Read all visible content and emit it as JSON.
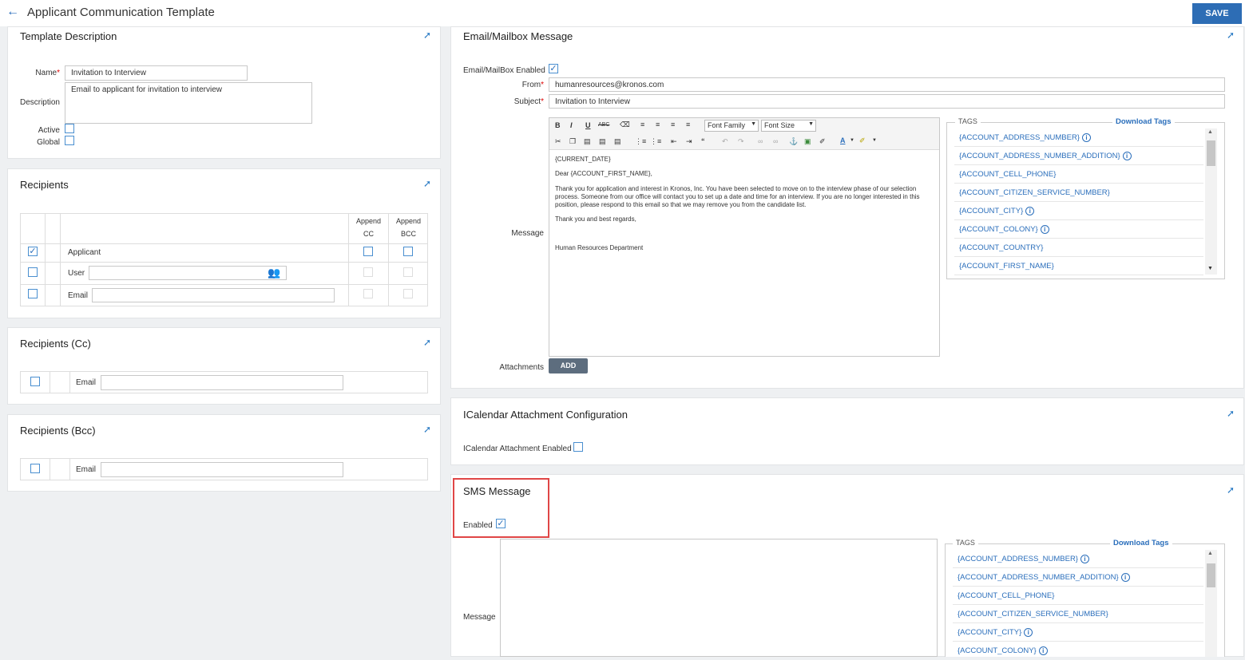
{
  "header": {
    "title": "Applicant Communication Template",
    "save_label": "SAVE"
  },
  "template_description": {
    "title": "Template Description",
    "name_label": "Name",
    "name_value": "Invitation to Interview",
    "description_label": "Description",
    "description_value": "Email to applicant for invitation to interview",
    "active_label": "Active",
    "global_label": "Global"
  },
  "recipients": {
    "title": "Recipients",
    "col_cc_1": "Append",
    "col_cc_2": "CC",
    "col_bcc_1": "Append",
    "col_bcc_2": "BCC",
    "rows": [
      {
        "label": "Applicant",
        "checked": true
      },
      {
        "label": "User",
        "checked": false
      },
      {
        "label": "Email",
        "checked": false
      }
    ]
  },
  "recipients_cc": {
    "title": "Recipients (Cc)",
    "email_label": "Email"
  },
  "recipients_bcc": {
    "title": "Recipients (Bcc)",
    "email_label": "Email"
  },
  "email_message": {
    "title": "Email/Mailbox Message",
    "enabled_label": "Email/MailBox Enabled",
    "from_label": "From",
    "from_value": "humanresources@kronos.com",
    "subject_label": "Subject",
    "subject_value": "Invitation to Interview",
    "message_label": "Message",
    "font_family": "Font Family",
    "font_size": "Font Size",
    "body": {
      "line1": "{CURRENT_DATE}",
      "line2": "Dear {ACCOUNT_FIRST_NAME},",
      "para1": "Thank you for application and interest in Kronos, Inc. You have been selected to move on to the interview phase of our selection process. Someone from our office will contact you to set up a date and time for an interview. If you are no longer interested in this position, please respond to this email so that we may remove you from the candidate list.",
      "line3": "Thank you and best regards,",
      "line4": "Human Resources Department"
    },
    "attachments_label": "Attachments",
    "add_label": "ADD",
    "tags_label": "TAGS",
    "download_tags": "Download Tags",
    "tags": [
      "{ACCOUNT_ADDRESS_NUMBER}",
      "{ACCOUNT_ADDRESS_NUMBER_ADDITION}",
      "{ACCOUNT_CELL_PHONE}",
      "{ACCOUNT_CITIZEN_SERVICE_NUMBER}",
      "{ACCOUNT_CITY}",
      "{ACCOUNT_COLONY}",
      "{ACCOUNT_COUNTRY}",
      "{ACCOUNT_FIRST_NAME}"
    ]
  },
  "icalendar": {
    "title": "ICalendar Attachment Configuration",
    "enabled_label": "ICalendar Attachment Enabled"
  },
  "sms": {
    "title": "SMS Message",
    "enabled_label": "Enabled",
    "message_label": "Message",
    "tags_label": "TAGS",
    "download_tags": "Download Tags",
    "tags": [
      "{ACCOUNT_ADDRESS_NUMBER}",
      "{ACCOUNT_ADDRESS_NUMBER_ADDITION}",
      "{ACCOUNT_CELL_PHONE}",
      "{ACCOUNT_CITIZEN_SERVICE_NUMBER}",
      "{ACCOUNT_CITY}",
      "{ACCOUNT_COLONY}"
    ]
  },
  "icons": {
    "back": "arrow-left-icon",
    "pin": "pin-icon",
    "info": "info-icon",
    "users": "user-lookup-icon"
  },
  "colors": {
    "accent": "#2d6db5",
    "link": "#2a6ebb",
    "highlight": "#e04646",
    "add_button": "#5d6d7e"
  }
}
